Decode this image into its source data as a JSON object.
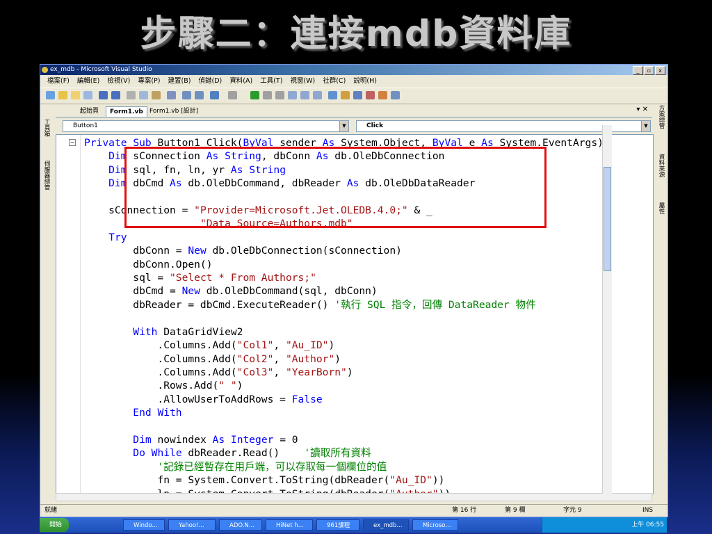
{
  "slide": {
    "title": "步驟二：連接mdb資料庫"
  },
  "window": {
    "title": "ex_mdb - Microsoft Visual Studio",
    "controls": [
      "_",
      "▫",
      "x"
    ]
  },
  "menu": [
    "檔案(F)",
    "編輯(E)",
    "檢視(V)",
    "專案(P)",
    "建置(B)",
    "偵錯(D)",
    "資料(A)",
    "工具(T)",
    "視窗(W)",
    "社群(C)",
    "說明(H)"
  ],
  "tabs": [
    "起始頁",
    "Form1.vb",
    "Form1.vb [設計]"
  ],
  "tab_controls": "▾ ✕",
  "combos": {
    "object": "Button1",
    "event": "Click"
  },
  "left_dock": [
    "工具箱",
    "伺服器總管"
  ],
  "right_dock": [
    "方案總管",
    "資料來源",
    "屬性"
  ],
  "code_lines": [
    "Private Sub Button1_Click(ByVal sender As System.Object, ByVal e As System.EventArgs)",
    "    Dim sConnection As String, dbConn As db.OleDbConnection",
    "    Dim sql, fn, ln, yr As String",
    "    Dim dbCmd As db.OleDbCommand, dbReader As db.OleDbDataReader",
    "",
    "    sConnection = \"Provider=Microsoft.Jet.OLEDB.4.0;\" & _",
    "                   \"Data Source=Authors.mdb\"",
    "    Try",
    "        dbConn = New db.OleDbConnection(sConnection)",
    "        dbConn.Open()",
    "        sql = \"Select * From Authors;\"",
    "        dbCmd = New db.OleDbCommand(sql, dbConn)",
    "        dbReader = dbCmd.ExecuteReader() '執行 SQL 指令，回傳 DataReader 物件",
    "",
    "        With DataGridView2",
    "            .Columns.Add(\"Col1\", \"Au_ID\")",
    "            .Columns.Add(\"Col2\", \"Author\")",
    "            .Columns.Add(\"Col3\", \"YearBorn\")",
    "            .Rows.Add(\" \")",
    "            .AllowUserToAddRows = False",
    "        End With",
    "",
    "        Dim nowindex As Integer = 0",
    "        Do While dbReader.Read()    '讀取所有資料",
    "            '記錄已經暫存在用戶端，可以存取每一個欄位的值",
    "            fn = System.Convert.ToString(dbReader(\"Au_ID\"))",
    "            ln = System.Convert.ToString(dbReader(\"Author\"))"
  ],
  "status": {
    "ready": "就緒",
    "line": "第 16 行",
    "col": "第 9 欄",
    "char": "字元 9",
    "mode": "INS"
  },
  "taskbar": {
    "start": "開始",
    "tasks": [
      "Windo...",
      "Yahoo!...",
      "ADO.N...",
      "HiNet h...",
      "961課程",
      "ex_mdb...",
      "Microso..."
    ],
    "clock": "上午 06:55"
  }
}
